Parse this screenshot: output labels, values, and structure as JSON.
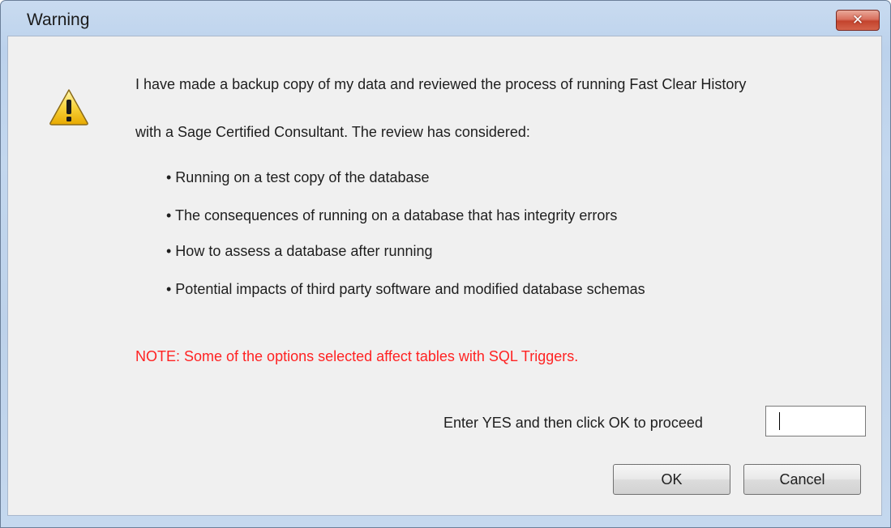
{
  "window": {
    "title": "Warning",
    "close_glyph": "✕"
  },
  "icons": {
    "warning": "warning-triangle-icon",
    "close": "close-icon"
  },
  "message": {
    "line1": "I have made a backup copy of my data and reviewed the process of running Fast Clear History",
    "line2": "with a Sage Certified Consultant. The review has considered:",
    "bullets": [
      "• Running on a test copy of the database",
      "• The consequences of running on a database that has integrity errors",
      "• How to assess a database after running",
      "• Potential impacts of third party software and modified database schemas"
    ],
    "note": "NOTE: Some of the options selected affect tables with SQL Triggers."
  },
  "confirm": {
    "label": "Enter YES and then click OK to proceed",
    "value": ""
  },
  "buttons": {
    "ok": "OK",
    "cancel": "Cancel"
  },
  "colors": {
    "note": "#ff2222",
    "client_background": "#f0f0f0",
    "frame": "#c3d7ee"
  }
}
